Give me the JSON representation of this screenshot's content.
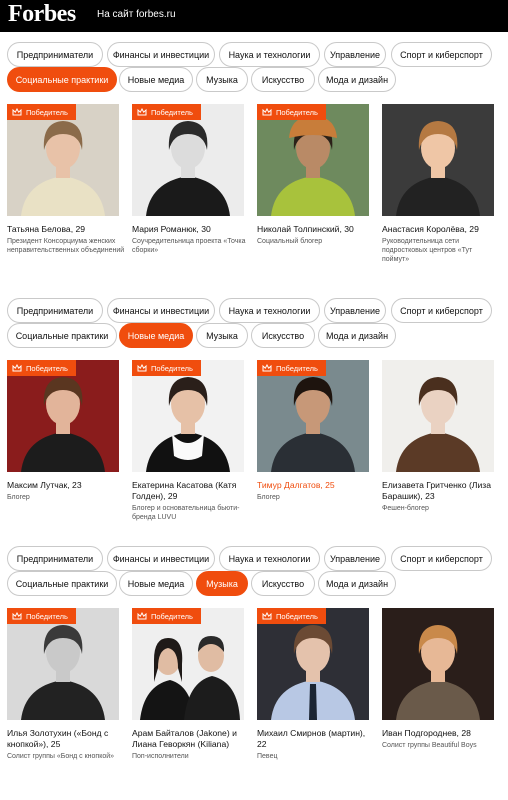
{
  "header": {
    "logo": "Forbes",
    "site_link": "На сайт forbes.ru"
  },
  "badge_label": "Победитель",
  "categories": [
    "Предприниматели",
    "Финансы и инвестиции",
    "Наука и технологии",
    "Управление",
    "Спорт и киберспорт",
    "Социальные практики",
    "Новые медиа",
    "Музыка",
    "Искусство",
    "Мода и дизайн"
  ],
  "sections": [
    {
      "active_category": "Социальные практики",
      "people": [
        {
          "name": "Татьяна Белова, 29",
          "desc": "Президент Консорциума женских неправительственных объединений",
          "winner": true
        },
        {
          "name": "Мария Романюк, 30",
          "desc": "Соучредительница проекта «Точка сборки»",
          "winner": true
        },
        {
          "name": "Николай Толпинский, 30",
          "desc": "Социальный блогер",
          "winner": true
        },
        {
          "name": "Анастасия Королёва, 29",
          "desc": "Руководительница сети подростковых центров «Тут поймут»",
          "winner": false
        }
      ]
    },
    {
      "active_category": "Новые медиа",
      "people": [
        {
          "name": "Максим Лутчак, 23",
          "desc": "Блогер",
          "winner": true
        },
        {
          "name": "Екатерина Касатова (Катя Голден), 29",
          "desc": "Блогер и основательница бьюти-бренда LUVU",
          "winner": true
        },
        {
          "name": "Тимур Далгатов, 25",
          "desc": "Блогер",
          "winner": true,
          "highlight": true
        },
        {
          "name": "Елизавета Гритченко (Лиза Барашик), 23",
          "desc": "Фешен-блогер",
          "winner": false
        }
      ]
    },
    {
      "active_category": "Музыка",
      "people": [
        {
          "name": "Илья Золотухин («Бонд с кнопкой»), 25",
          "desc": "Солист группы «Бонд с кнопкой»",
          "winner": true
        },
        {
          "name": "Арам Байталов (Jakone) и Лиана Геворкян (Kiliana)",
          "desc": "Поп-исполнители",
          "winner": true
        },
        {
          "name": "Михаил Смирнов (мартин), 22",
          "desc": "Певец",
          "winner": true
        },
        {
          "name": "Иван Подгороднев, 28",
          "desc": "Солист группы Beautiful Boys",
          "winner": false
        }
      ]
    }
  ]
}
